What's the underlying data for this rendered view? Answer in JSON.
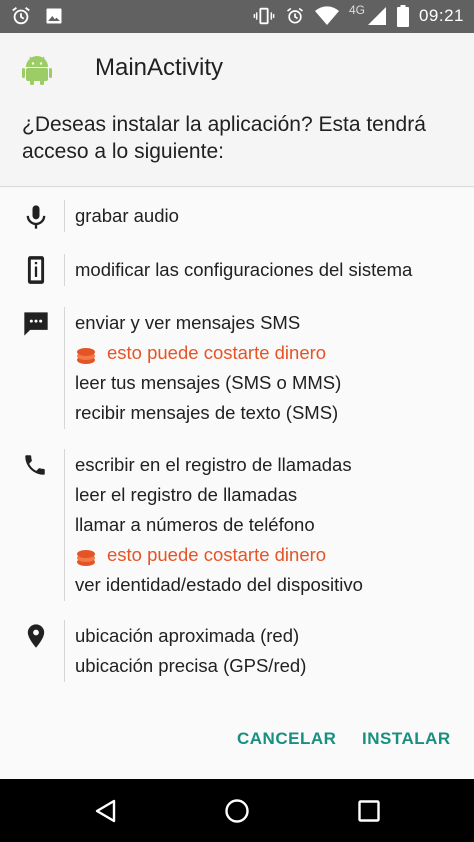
{
  "status_bar": {
    "network": "4G",
    "time": "09:21"
  },
  "header": {
    "app_name": "MainActivity",
    "question": "¿Deseas instalar la aplicación? Esta tendrá acceso a lo siguiente:"
  },
  "permission_groups": [
    {
      "icon": "microphone-icon",
      "items": [
        {
          "text": "grabar audio",
          "cost": false
        }
      ]
    },
    {
      "icon": "device-settings-icon",
      "items": [
        {
          "text": "modificar las configuraciones del sistema",
          "cost": false
        }
      ]
    },
    {
      "icon": "sms-message-icon",
      "items": [
        {
          "text": "enviar y ver mensajes SMS",
          "cost": false
        },
        {
          "text": "esto puede costarte dinero",
          "cost": true
        },
        {
          "text": "leer tus mensajes (SMS o MMS)",
          "cost": false
        },
        {
          "text": "recibir mensajes de texto (SMS)",
          "cost": false
        }
      ]
    },
    {
      "icon": "phone-icon",
      "items": [
        {
          "text": "escribir en el registro de llamadas",
          "cost": false
        },
        {
          "text": "leer el registro de llamadas",
          "cost": false
        },
        {
          "text": "llamar a números de teléfono",
          "cost": false
        },
        {
          "text": "esto puede costarte dinero",
          "cost": true
        },
        {
          "text": "ver identidad/estado del dispositivo",
          "cost": false
        }
      ]
    },
    {
      "icon": "location-pin-icon",
      "items": [
        {
          "text": "ubicación aproximada (red)",
          "cost": false
        },
        {
          "text": "ubicación precisa (GPS/red)",
          "cost": false
        }
      ]
    }
  ],
  "actions": {
    "cancel_label": "CANCELAR",
    "install_label": "INSTALAR"
  },
  "colors": {
    "accent": "#18907f",
    "cost_warning": "#e55425",
    "status_bar": "#616161",
    "nav_bar": "#000000"
  }
}
